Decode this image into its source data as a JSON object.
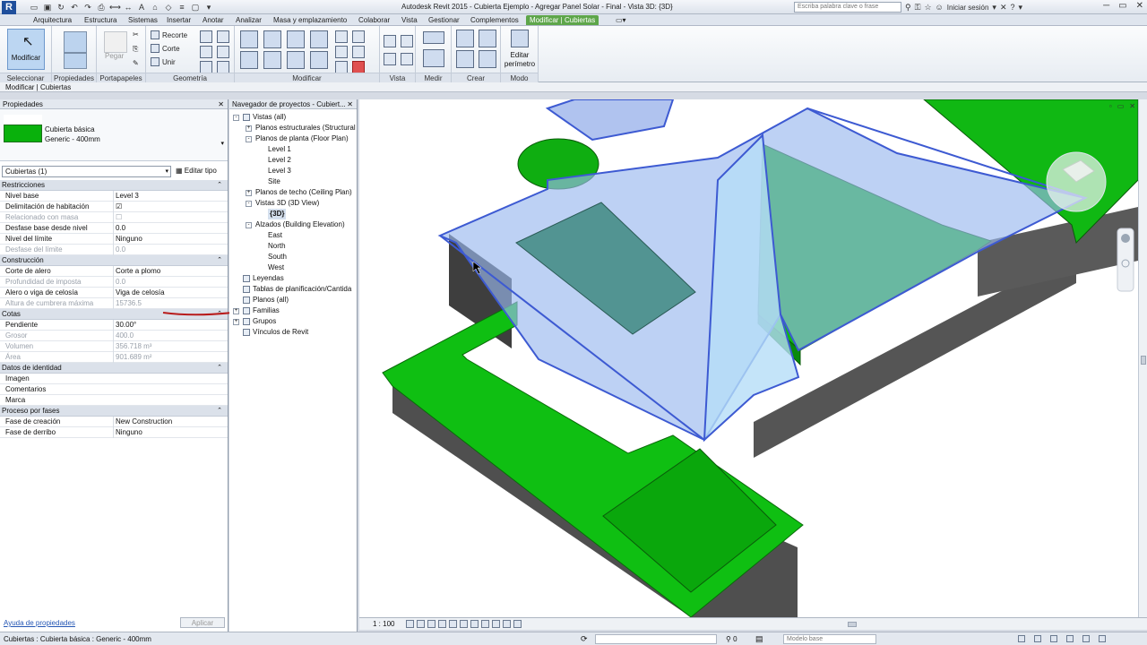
{
  "app": {
    "title": "Autodesk Revit 2015 -  Cubierta Ejemplo - Agregar Panel Solar - Final - Vista 3D: {3D}",
    "logo": "R"
  },
  "search": {
    "placeholder": "Escriba palabra clave o frase"
  },
  "user": {
    "signin": "Iniciar sesión"
  },
  "tabs": [
    "Arquitectura",
    "Estructura",
    "Sistemas",
    "Insertar",
    "Anotar",
    "Analizar",
    "Masa y emplazamiento",
    "Colaborar",
    "Vista",
    "Gestionar",
    "Complementos",
    "Modificar | Cubiertas"
  ],
  "ribbon": {
    "modify_label": "Modificar",
    "paste_label": "Pegar",
    "cut_label": "Recorte",
    "cope_label": "Corte",
    "join_label": "Unir",
    "edit_footprint": [
      "Editar",
      "perímetro"
    ],
    "groups": [
      "Seleccionar",
      "Propiedades",
      "Portapapeles",
      "Geometría",
      "Modificar",
      "Vista",
      "Medir",
      "Crear",
      "Modo"
    ]
  },
  "context_bar": {
    "label": "Modificar | Cubiertas"
  },
  "properties": {
    "panel_title": "Propiedades",
    "type_family": "Cubierta básica",
    "type_name": "Generic - 400mm",
    "instance_selector": "Cubiertas (1)",
    "edit_type": "Editar tipo",
    "sections": [
      {
        "name": "Restricciones",
        "rows": [
          {
            "key": "Nivel base",
            "value": "Level 3",
            "dis": false
          },
          {
            "key": "Delimitación de habitación",
            "value": "☑",
            "dis": false
          },
          {
            "key": "Relacionado con masa",
            "value": "☐",
            "dis": true
          },
          {
            "key": "Desfase base desde nivel",
            "value": "0.0",
            "dis": false
          },
          {
            "key": "Nivel del límite",
            "value": "Ninguno",
            "dis": false
          },
          {
            "key": "Desfase del límite",
            "value": "0.0",
            "dis": true
          }
        ]
      },
      {
        "name": "Construcción",
        "rows": [
          {
            "key": "Corte de alero",
            "value": "Corte a plomo",
            "dis": false
          },
          {
            "key": "Profundidad de imposta",
            "value": "0.0",
            "dis": true
          },
          {
            "key": "Alero o viga de celosía",
            "value": "Viga de celosía",
            "dis": false
          },
          {
            "key": "Altura de cumbrera máxima",
            "value": "15736.5",
            "dis": true
          }
        ]
      },
      {
        "name": "Cotas",
        "rows": [
          {
            "key": "Pendiente",
            "value": "30.00°",
            "dis": false
          },
          {
            "key": "Grosor",
            "value": "400.0",
            "dis": true
          },
          {
            "key": "Volumen",
            "value": "356.718 m³",
            "dis": true
          },
          {
            "key": "Área",
            "value": "901.689 m²",
            "dis": true
          }
        ]
      },
      {
        "name": "Datos de identidad",
        "rows": [
          {
            "key": "Imagen",
            "value": "",
            "dis": false
          },
          {
            "key": "Comentarios",
            "value": "",
            "dis": false
          },
          {
            "key": "Marca",
            "value": "",
            "dis": false
          }
        ]
      },
      {
        "name": "Proceso por fases",
        "rows": [
          {
            "key": "Fase de creación",
            "value": "New Construction",
            "dis": false
          },
          {
            "key": "Fase de derribo",
            "value": "Ninguno",
            "dis": false
          }
        ]
      }
    ],
    "help_link": "Ayuda de propiedades",
    "apply": "Aplicar"
  },
  "navigator": {
    "panel_title": "Navegador de proyectos - Cubiert...",
    "tree": [
      {
        "label": "Vistas (all)",
        "level": 0,
        "exp": "-",
        "icon": true
      },
      {
        "label": "Planos estructurales (Structural",
        "level": 1,
        "exp": "+",
        "icon": false
      },
      {
        "label": "Planos de planta (Floor Plan)",
        "level": 1,
        "exp": "-",
        "icon": false
      },
      {
        "label": "Level 1",
        "level": 2,
        "exp": "",
        "icon": false
      },
      {
        "label": "Level 2",
        "level": 2,
        "exp": "",
        "icon": false
      },
      {
        "label": "Level 3",
        "level": 2,
        "exp": "",
        "icon": false
      },
      {
        "label": "Site",
        "level": 2,
        "exp": "",
        "icon": false
      },
      {
        "label": "Planos de techo (Ceiling Plan)",
        "level": 1,
        "exp": "+",
        "icon": false
      },
      {
        "label": "Vistas 3D (3D View)",
        "level": 1,
        "exp": "-",
        "icon": false
      },
      {
        "label": "{3D}",
        "level": 2,
        "exp": "",
        "icon": false,
        "bold": true
      },
      {
        "label": "Alzados (Building Elevation)",
        "level": 1,
        "exp": "-",
        "icon": false
      },
      {
        "label": "East",
        "level": 2,
        "exp": "",
        "icon": false
      },
      {
        "label": "North",
        "level": 2,
        "exp": "",
        "icon": false
      },
      {
        "label": "South",
        "level": 2,
        "exp": "",
        "icon": false
      },
      {
        "label": "West",
        "level": 2,
        "exp": "",
        "icon": false
      },
      {
        "label": "Leyendas",
        "level": 0,
        "exp": "",
        "icon": true
      },
      {
        "label": "Tablas de planificación/Cantida",
        "level": 0,
        "exp": "",
        "icon": true
      },
      {
        "label": "Planos (all)",
        "level": 0,
        "exp": "",
        "icon": true
      },
      {
        "label": "Familias",
        "level": 0,
        "exp": "+",
        "icon": true
      },
      {
        "label": "Grupos",
        "level": 0,
        "exp": "+",
        "icon": true
      },
      {
        "label": "Vínculos de Revit",
        "level": 0,
        "exp": "",
        "icon": true
      }
    ]
  },
  "viewport": {
    "scale": "1 : 100"
  },
  "status": {
    "text": "Cubiertas : Cubierta básica : Generic - 400mm",
    "zero": "0",
    "model": "Modelo base"
  },
  "colors": {
    "roof_green": "#09b10c",
    "selection_blue": "#4a6fd8",
    "accent_tab": "#5ea64a"
  }
}
